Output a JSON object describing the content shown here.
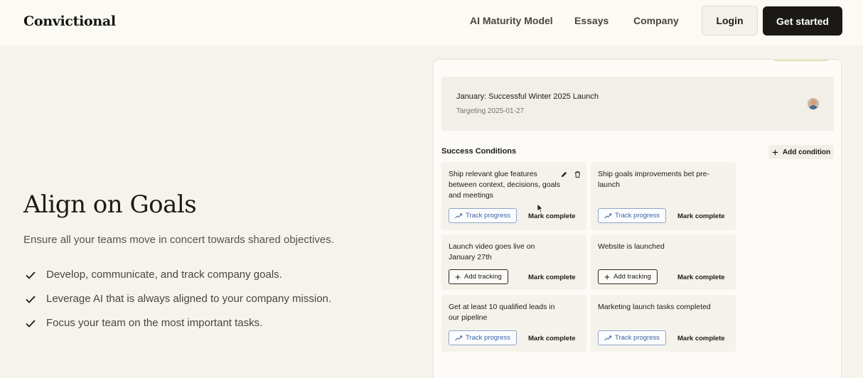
{
  "header": {
    "logo": "Convictional",
    "nav": [
      {
        "label": "AI Maturity Model"
      },
      {
        "label": "Essays"
      },
      {
        "label": "Company"
      }
    ],
    "login_label": "Login",
    "get_started_label": "Get started"
  },
  "hero": {
    "title": "Align on Goals",
    "subtitle": "Ensure all your teams move in concert towards shared objectives.",
    "bullets": [
      "Develop, communicate, and track company goals.",
      "Leverage AI that is always aligned to your company mission.",
      "Focus your team on the most important tasks."
    ]
  },
  "panel": {
    "goal": {
      "title": "January: Successful Winter 2025 Launch",
      "target": "Targeting 2025-01-27"
    },
    "success_heading": "Success Conditions",
    "add_condition_label": "Add condition",
    "conditions": [
      {
        "text": "Ship relevant glue features between context, decisions, goals and meetings",
        "action": "Track progress",
        "mark": "Mark complete"
      },
      {
        "text": "Ship goals improvements bet pre-launch",
        "action": "Track progress",
        "mark": "Mark complete"
      },
      {
        "text": "Launch video goes live on January 27th",
        "action": "Add tracking",
        "mark": "Mark complete"
      },
      {
        "text": "Website is launched",
        "action": "Add tracking",
        "mark": "Mark complete"
      },
      {
        "text": "Get at least 10 qualified leads in our pipeline",
        "action": "Track progress",
        "mark": "Mark complete"
      },
      {
        "text": "Marketing launch tasks completed",
        "action": "Track progress",
        "mark": "Mark complete"
      }
    ]
  },
  "colors": {
    "background": "#f6f3ec",
    "header_bg": "#fbfaf5",
    "primary_button": "#1b1915",
    "track_accent": "#3b63a5"
  },
  "icons": [
    "check-icon",
    "plus-icon",
    "pencil-icon",
    "trash-icon",
    "trend-icon",
    "avatar",
    "cursor-icon"
  ]
}
